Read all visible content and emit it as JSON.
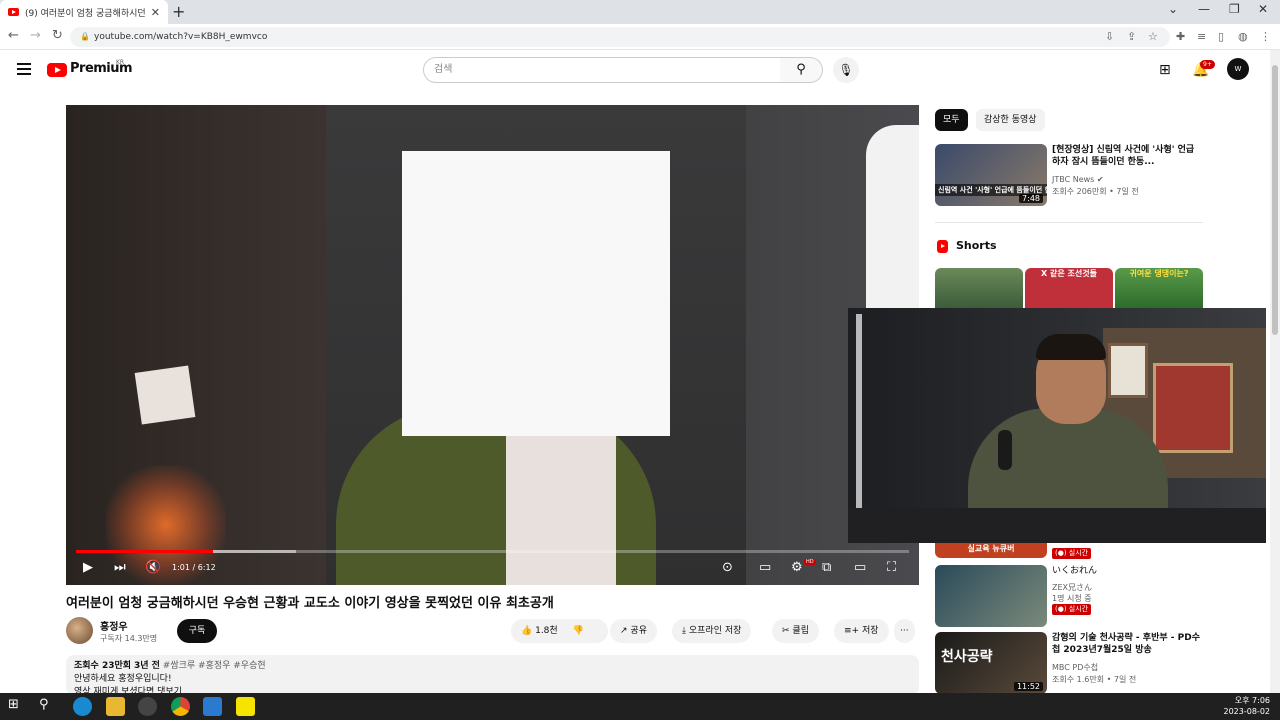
{
  "browser": {
    "tab_title": "(9) 여러분이 엄청 궁금해하시던",
    "tab_close": "✕",
    "new_tab": "+",
    "url": "youtube.com/watch?v=KB8H_ewmvco",
    "window_controls": [
      "⌄",
      "—",
      "❐",
      "✕"
    ]
  },
  "header": {
    "logo_text": "Premium",
    "logo_region": "KR",
    "search_placeholder": "검색",
    "notification_count": "9+",
    "avatar_text": "W"
  },
  "player": {
    "time": "1:01 / 6:12",
    "progress": 0.164,
    "hd_label": "HD"
  },
  "video": {
    "title": "여러분이 엄청 궁금해하시던 우승현 근황과 교도소 이야기 영상을 못찍었던 이유 최초공개",
    "channel": "홍정우",
    "subscribers": "구독자 14.3만명",
    "subscribe_label": "구독",
    "likes": "1.8천",
    "share": "공유",
    "download": "오프라인 저장",
    "clip": "클립",
    "save": "저장",
    "more": "···"
  },
  "description": {
    "views": "조회수 23만회",
    "date": "3년 전",
    "tags": "#쌈크루 #홍정우 #우승현",
    "line1": "안녕하세요 홍정우입니다!",
    "line2": "영상 재미게 보셨다면 댓보기"
  },
  "sidebar": {
    "chips": [
      "모두",
      "감상한 동영상"
    ],
    "rec1": {
      "title": "[현장영상] 신림역 사건에 '사형' 언급하자 잠시 뜸들이던 한동...",
      "channel": "JTBC News",
      "meta": "조회수 206만회 • 7일 전",
      "duration": "7:48",
      "thumb_caption": "신림역 사건 '사형' 언급에 뜸들이던 한동훈..."
    },
    "shorts_label": "Shorts",
    "shorts": [
      {
        "caption": ""
      },
      {
        "caption": "X 같은 조선것들"
      },
      {
        "caption": "귀여운 댕댕이는?"
      }
    ],
    "live_text": "실시간",
    "live1_caption": "실교육 뉴큐버",
    "rec3": {
      "title": "いくおれん",
      "channel": "ZEX兄さん",
      "meta": "1명 시청 중",
      "live": "실시간"
    },
    "rec4": {
      "title": "감형의 기술 천사공략 - 후반부 - PD수첩 2023년7월25일 방송",
      "channel": "MBC PD수첩",
      "meta": "조회수 1.6만회 • 7일 전",
      "duration": "11:52",
      "thumb_caption": "천사공략"
    }
  },
  "taskbar": {
    "time": "오후 7:06",
    "date": "2023-08-02"
  },
  "colors": {
    "brand_red": "#ff0000",
    "live_red": "#cc0000",
    "dark": "#0f0f0f"
  }
}
